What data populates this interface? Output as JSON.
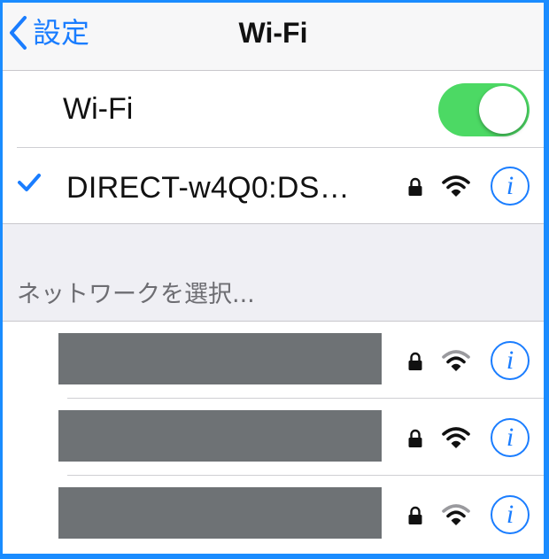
{
  "nav": {
    "back_label": "設定",
    "title": "Wi-Fi"
  },
  "wifi_toggle": {
    "label": "Wi-Fi",
    "on": true,
    "color": "#4cd964"
  },
  "connected_network": {
    "name": "DIRECT-w4Q0:DS…",
    "secured": true,
    "selected": true,
    "info_label": "i"
  },
  "choose_network_header": "ネットワークを選択...",
  "networks": [
    {
      "name_redacted": true,
      "secured": true,
      "signal": "medium",
      "info_label": "i"
    },
    {
      "name_redacted": true,
      "secured": true,
      "signal": "full",
      "info_label": "i"
    },
    {
      "name_redacted": true,
      "secured": true,
      "signal": "medium",
      "info_label": "i"
    }
  ],
  "colors": {
    "accent": "#1a7dff",
    "frame_border": "#1a8cff",
    "redaction": "#6e7275"
  }
}
